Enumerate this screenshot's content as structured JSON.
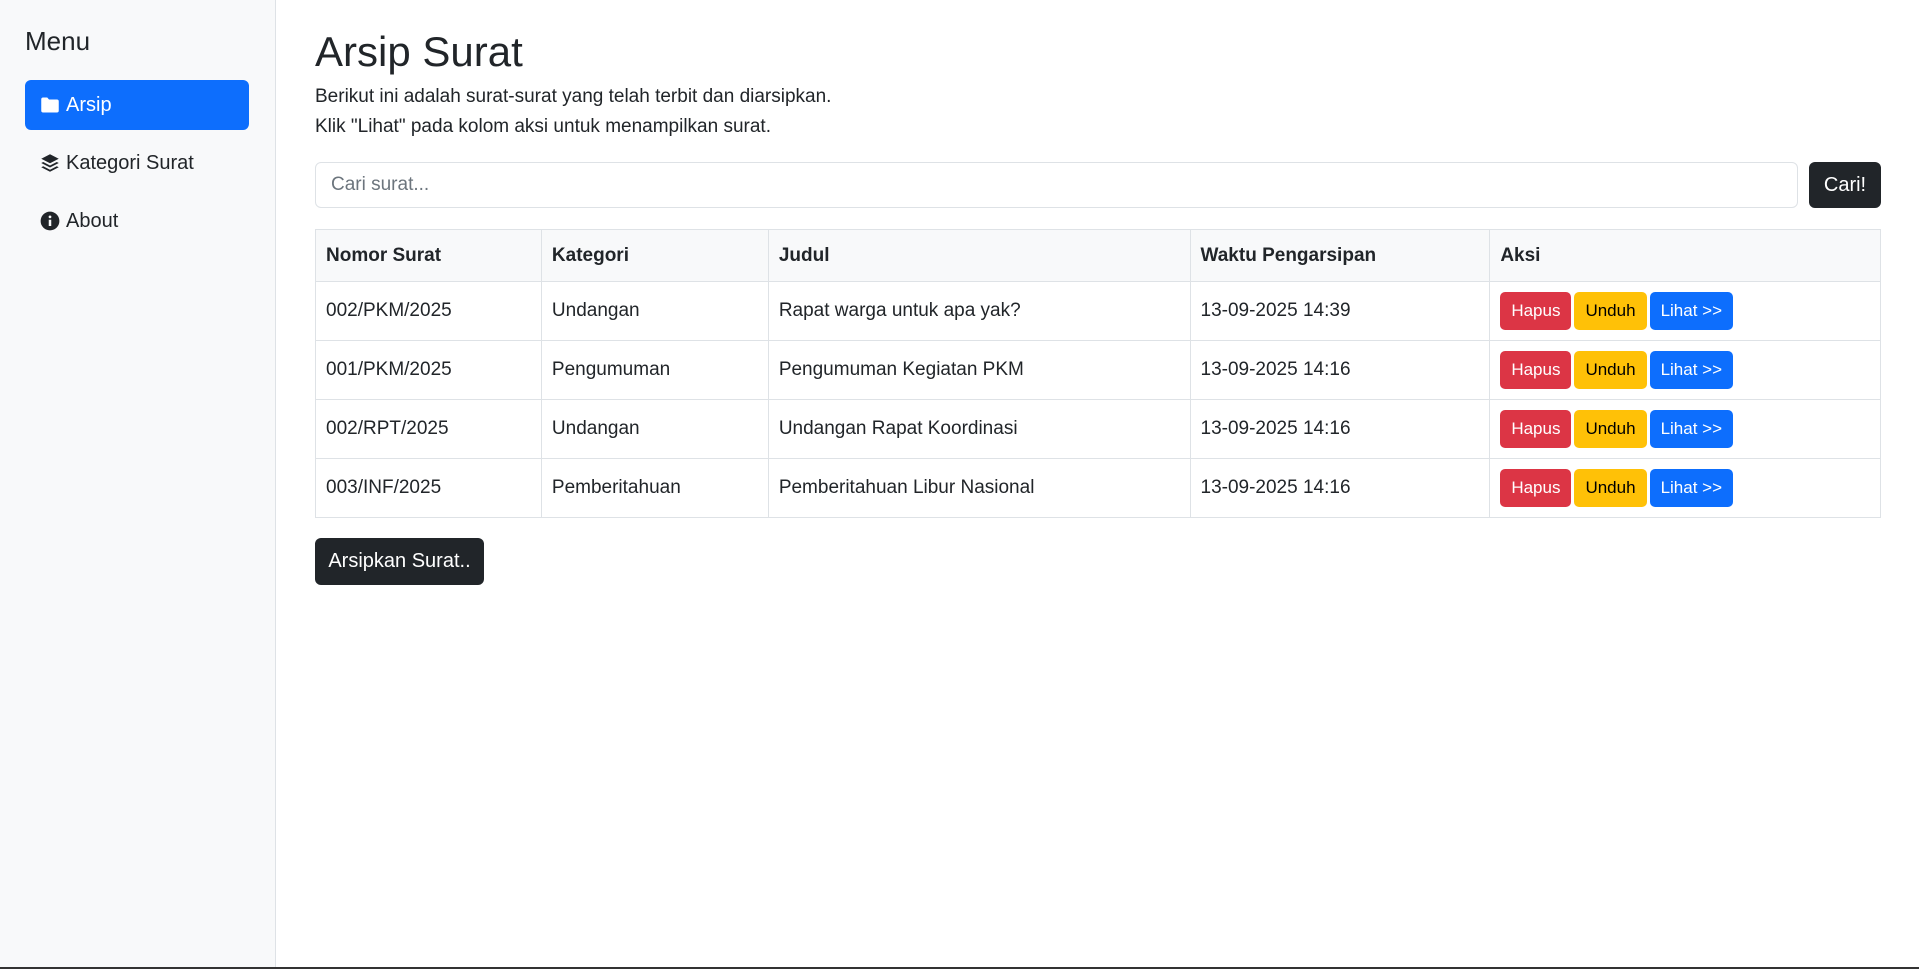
{
  "sidebar": {
    "title": "Menu",
    "items": [
      {
        "label": "Arsip",
        "icon": "folder-icon",
        "active": true
      },
      {
        "label": "Kategori Surat",
        "icon": "layers-icon",
        "active": false
      },
      {
        "label": "About",
        "icon": "info-circle-icon",
        "active": false
      }
    ]
  },
  "main": {
    "title": "Arsip Surat",
    "description_line1": "Berikut ini adalah surat-surat yang telah terbit dan diarsipkan.",
    "description_line2": "Klik \"Lihat\" pada kolom aksi untuk menampilkan surat.",
    "search": {
      "placeholder": "Cari surat...",
      "value": "",
      "button_label": "Cari!"
    },
    "table": {
      "headers": [
        "Nomor Surat",
        "Kategori",
        "Judul",
        "Waktu Pengarsipan",
        "Aksi"
      ],
      "rows": [
        {
          "nomor": "002/PKM/2025",
          "kategori": "Undangan",
          "judul": "Rapat warga untuk apa yak?",
          "waktu": "13-09-2025 14:39"
        },
        {
          "nomor": "001/PKM/2025",
          "kategori": "Pengumuman",
          "judul": "Pengumuman Kegiatan PKM",
          "waktu": "13-09-2025 14:16"
        },
        {
          "nomor": "002/RPT/2025",
          "kategori": "Undangan",
          "judul": "Undangan Rapat Koordinasi",
          "waktu": "13-09-2025 14:16"
        },
        {
          "nomor": "003/INF/2025",
          "kategori": "Pemberitahuan",
          "judul": "Pemberitahuan Libur Nasional",
          "waktu": "13-09-2025 14:16"
        }
      ],
      "actions": {
        "delete": "Hapus",
        "download": "Unduh",
        "view": "Lihat >>"
      }
    },
    "archive_button_label": "Arsipkan Surat.."
  },
  "colors": {
    "primary": "#0d6efd",
    "danger": "#dc3545",
    "warning": "#ffc107",
    "dark": "#212529",
    "sidebar_bg": "#f8f9fa"
  }
}
